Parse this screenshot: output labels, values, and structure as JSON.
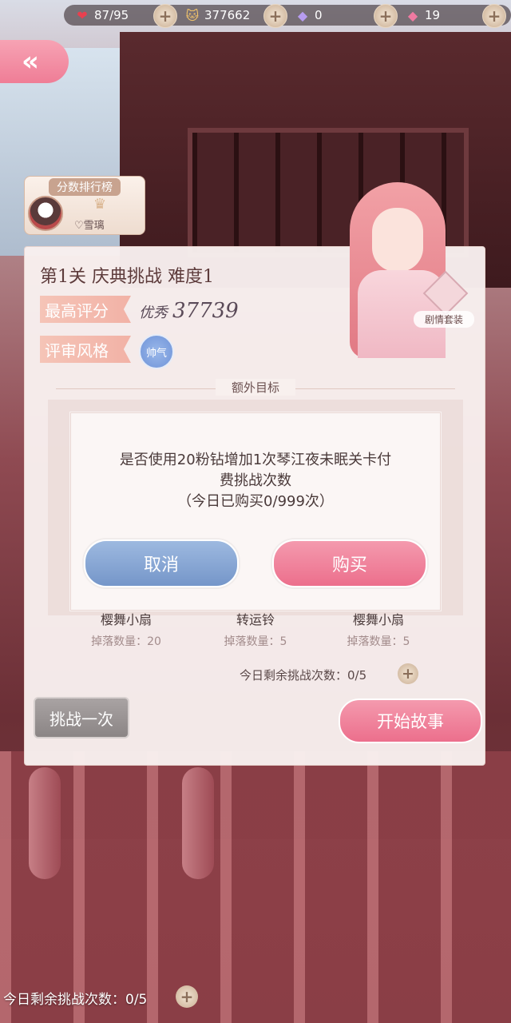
{
  "resources": {
    "stamina": "87/95",
    "coins": "377662",
    "diamonds": "0",
    "pink_diamonds": "19"
  },
  "icons": {
    "stamina": "heart-icon",
    "coins": "cat-coin-icon",
    "diamonds": "diamond-icon",
    "pink_diamonds": "pink-diamond-icon",
    "back": "double-chevron-left-icon",
    "plus": "plus-icon"
  },
  "leaderboard": {
    "title": "分数排行榜",
    "player_name": "♡雪璃"
  },
  "level": {
    "title": "第1关 庆典挑战 难度1",
    "best_score_label": "最高评分",
    "best_grade": "优秀",
    "best_score": "37739",
    "judge_style_label": "评审风格",
    "judge_style": "帅气",
    "costume_label": "剧情套装",
    "extra_goals_title": "额外目标"
  },
  "dialog": {
    "message_line1": "是否使用20粉钻增加1次琴江夜未眠关卡付",
    "message_line2": "费挑战次数",
    "message_line3": "（今日已购买0/999次）",
    "cancel_label": "取消",
    "buy_label": "购买"
  },
  "rewards": [
    {
      "name": "樱舞小扇",
      "drop": "掉落数量：20"
    },
    {
      "name": "转运铃",
      "drop": "掉落数量：5"
    },
    {
      "name": "樱舞小扇",
      "drop": "掉落数量：5"
    }
  ],
  "remaining_text": "今日剩余挑战次数：0/5",
  "buttons": {
    "challenge_once": "挑战一次",
    "start_story": "开始故事"
  },
  "bottom_remaining_text": "今日剩余挑战次数：0/5",
  "colors": {
    "pink_button": "#ec6f8c",
    "blue_button": "#7596c9",
    "card_bg": "#f8f0ee"
  }
}
